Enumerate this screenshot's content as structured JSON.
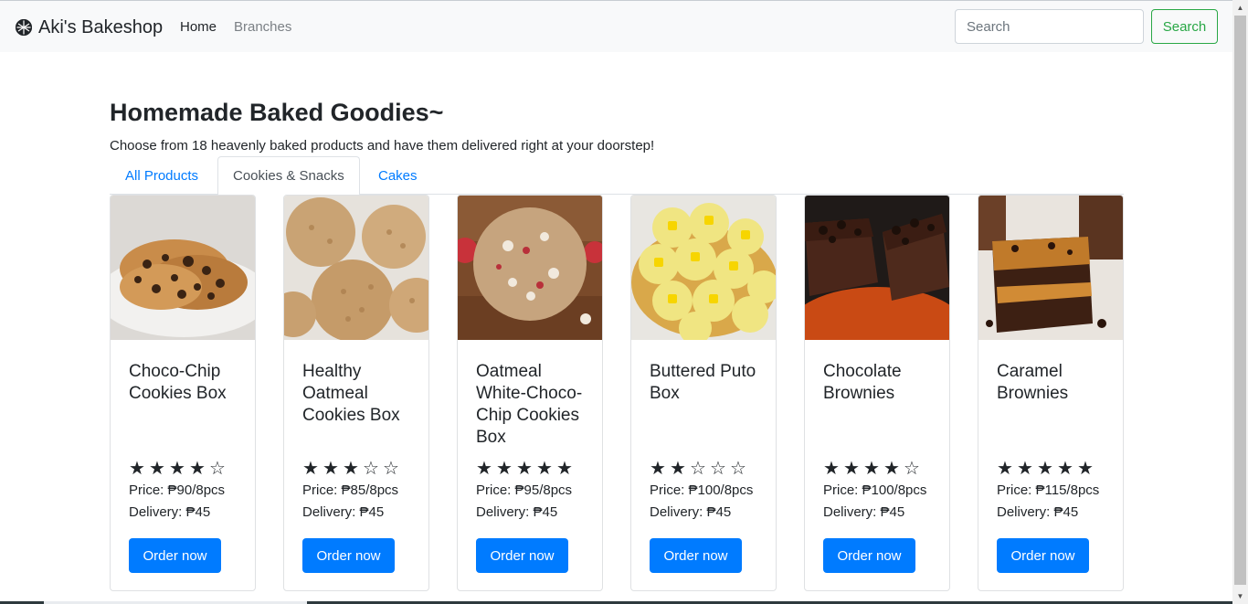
{
  "navbar": {
    "brand": "Aki's Bakeshop",
    "links": [
      "Home",
      "Branches"
    ],
    "search_placeholder": "Search",
    "search_button": "Search"
  },
  "main": {
    "title": "Homemade Baked Goodies~",
    "subtitle": "Choose from 18 heavenly baked products and have them delivered right at your doorstep!",
    "tabs": [
      "All Products",
      "Cookies & Snacks",
      "Cakes"
    ],
    "active_tab": "Cookies & Snacks"
  },
  "products": [
    {
      "name": "Choco-Chip Cookies Box",
      "rating": 4,
      "price": "Price: ₱90/8pcs",
      "delivery": "Delivery: ₱45",
      "button": "Order now"
    },
    {
      "name": "Healthy Oatmeal Cookies Box",
      "rating": 3,
      "price": "Price: ₱85/8pcs",
      "delivery": "Delivery: ₱45",
      "button": "Order now"
    },
    {
      "name": "Oatmeal White-Choco-Chip Cookies Box",
      "rating": 5,
      "price": "Price: ₱95/8pcs",
      "delivery": "Delivery: ₱45",
      "button": "Order now"
    },
    {
      "name": "Buttered Puto Box",
      "rating": 2,
      "price": "Price: ₱100/8pcs",
      "delivery": "Delivery: ₱45",
      "button": "Order now"
    },
    {
      "name": "Chocolate Brownies",
      "rating": 4,
      "price": "Price: ₱100/8pcs",
      "delivery": "Delivery: ₱45",
      "button": "Order now"
    },
    {
      "name": "Caramel Brownies",
      "rating": 5,
      "price": "Price: ₱115/8pcs",
      "delivery": "Delivery: ₱45",
      "button": "Order now"
    }
  ],
  "colors": {
    "primary": "#007bff",
    "success": "#28a745",
    "navbar_bg": "#f8f9fa",
    "text": "#212529"
  }
}
